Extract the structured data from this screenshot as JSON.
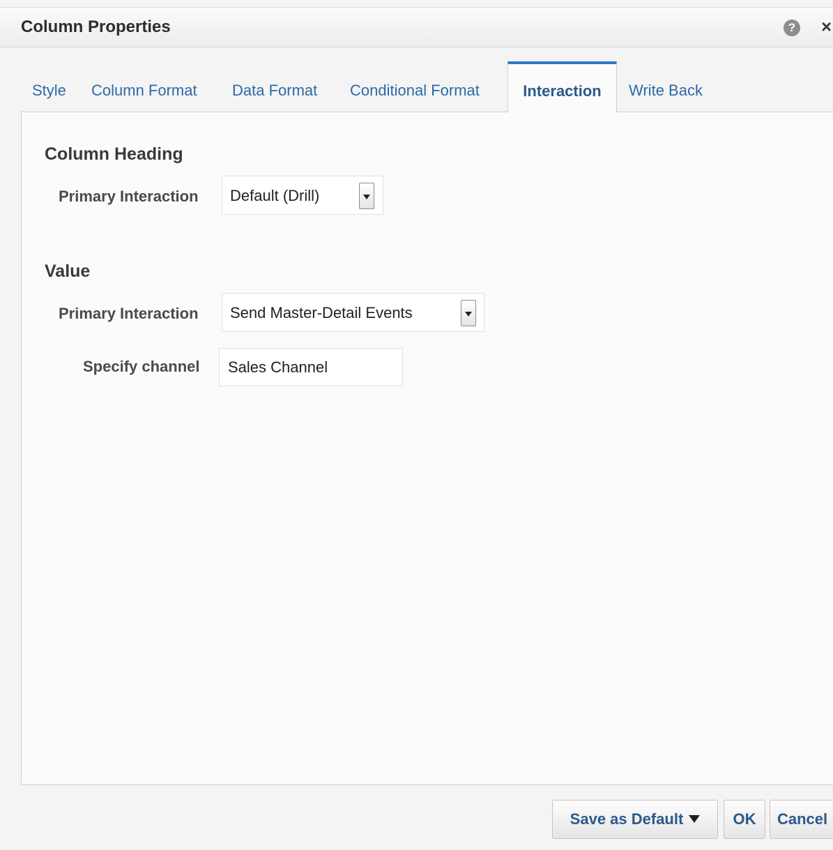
{
  "dialog": {
    "title": "Column Properties",
    "help_icon": "help-icon",
    "close_icon": "close-icon"
  },
  "tabs": [
    {
      "label": "Style",
      "active": false
    },
    {
      "label": "Column Format",
      "active": false
    },
    {
      "label": "Data Format",
      "active": false
    },
    {
      "label": "Conditional Format",
      "active": false
    },
    {
      "label": "Interaction",
      "active": true
    },
    {
      "label": "Write Back",
      "active": false
    }
  ],
  "column_heading": {
    "title": "Column Heading",
    "primary_interaction_label": "Primary Interaction",
    "primary_interaction_value": "Default (Drill)"
  },
  "value": {
    "title": "Value",
    "primary_interaction_label": "Primary Interaction",
    "primary_interaction_value": "Send Master-Detail Events",
    "channel_label": "Specify channel",
    "channel_value": "Sales Channel"
  },
  "footer": {
    "save_default_label": "Save as Default",
    "ok_label": "OK",
    "cancel_label": "Cancel"
  },
  "colors": {
    "accent": "#2f7ac4",
    "link": "#2d6aa8",
    "button_text": "#2b5a8c"
  }
}
